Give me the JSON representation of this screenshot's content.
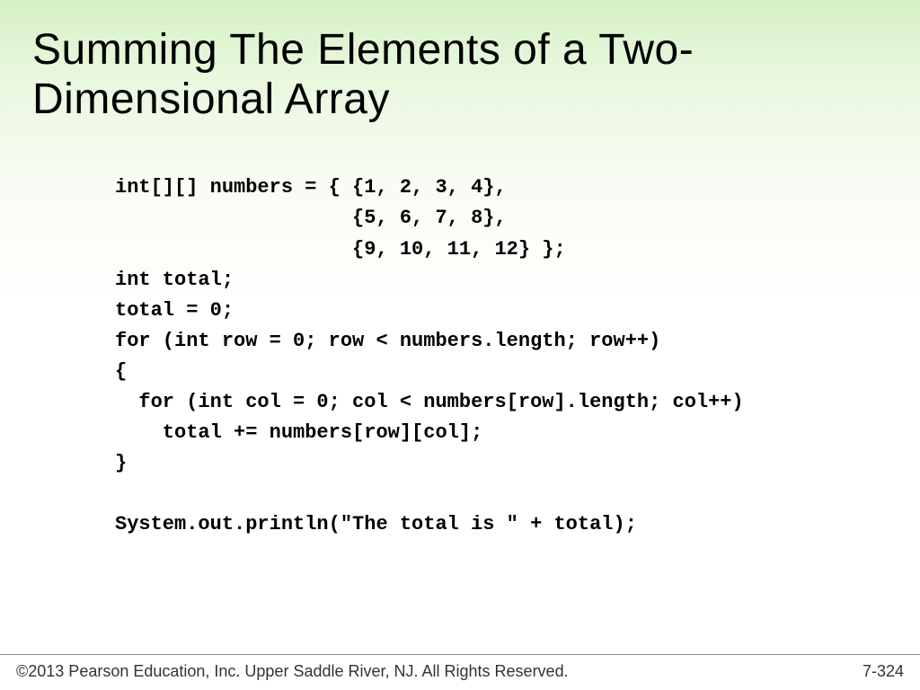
{
  "slide": {
    "title": "Summing The Elements of a Two-Dimensional Array",
    "code": "int[][] numbers = { {1, 2, 3, 4},\n                    {5, 6, 7, 8},\n                    {9, 10, 11, 12} };\nint total;\ntotal = 0;\nfor (int row = 0; row < numbers.length; row++)\n{\n  for (int col = 0; col < numbers[row].length; col++)\n    total += numbers[row][col];\n}\n\nSystem.out.println(\"The total is \" + total);"
  },
  "footer": {
    "copyright": "©2013 Pearson Education, Inc. Upper Saddle River, NJ. All Rights Reserved.",
    "page": "7-324"
  }
}
